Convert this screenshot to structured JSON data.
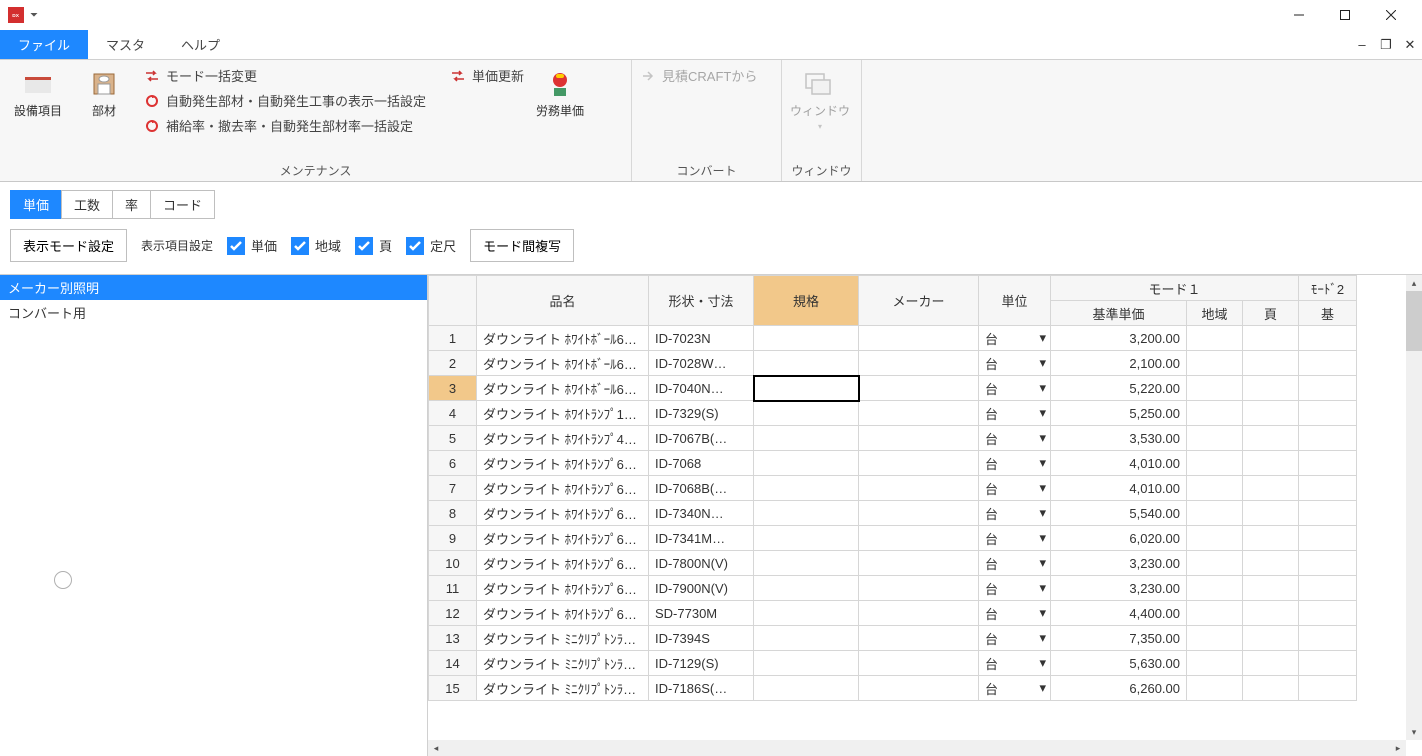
{
  "app": {
    "icon_text": "CRAFT DX",
    "qat_glyph": "⏷"
  },
  "window_controls": {
    "min": "–",
    "max": "☐",
    "close": "✕"
  },
  "menu": {
    "tabs": [
      {
        "label": "ファイル",
        "active": true
      },
      {
        "label": "マスタ",
        "active": false
      },
      {
        "label": "ヘルプ",
        "active": false
      }
    ],
    "mdi": {
      "min": "–",
      "restore": "❐",
      "close": "✕"
    }
  },
  "ribbon": {
    "groups": [
      {
        "label": "メンテナンス",
        "big": [
          {
            "text": "設備項目",
            "icon": "folder"
          },
          {
            "text": "部材",
            "icon": "toilet"
          }
        ],
        "items": [
          {
            "text": "モード一括変更",
            "icon": "swap"
          },
          {
            "text": "自動発生部材・自動発生工事の表示一括設定",
            "icon": "cycle-red"
          },
          {
            "text": "補給率・撤去率・自動発生部材率一括設定",
            "icon": "cycle-red"
          }
        ],
        "right_items": [
          {
            "text": "単価更新",
            "icon": "swap"
          }
        ],
        "right_big": [
          {
            "text": "労務単価",
            "icon": "worker"
          }
        ]
      },
      {
        "label": "コンバート",
        "items": [
          {
            "text": "見積CRAFTから",
            "icon": "arrow",
            "disabled": true
          }
        ]
      },
      {
        "label": "ウィンドウ",
        "big": [
          {
            "text": "ウィンドウ",
            "icon": "window",
            "disabled": true,
            "dropdown": true
          }
        ]
      }
    ]
  },
  "subtabs": [
    {
      "label": "単価",
      "active": true
    },
    {
      "label": "工数",
      "active": false
    },
    {
      "label": "率",
      "active": false
    },
    {
      "label": "コード",
      "active": false
    }
  ],
  "toolbar": {
    "display_mode": "表示モード設定",
    "display_items": "表示項目設定",
    "checks": [
      {
        "label": "単価"
      },
      {
        "label": "地域"
      },
      {
        "label": "頁"
      },
      {
        "label": "定尺"
      }
    ],
    "mode_copy": "モード間複写"
  },
  "sidebar": {
    "items": [
      {
        "label": "メーカー別照明",
        "selected": true
      },
      {
        "label": "コンバート用",
        "selected": false
      }
    ]
  },
  "grid": {
    "header_top": {
      "name": "品名",
      "shape": "形状・寸法",
      "spec": "規格",
      "maker": "メーカー",
      "unit": "単位",
      "mode1": "モード１",
      "mode2": "ﾓｰﾄﾞ2"
    },
    "header_sub": {
      "price": "基準単価",
      "region": "地域",
      "page": "頁",
      "base2": "基"
    },
    "selected_row": 3,
    "rows": [
      {
        "n": 1,
        "name": "ダウンライト ﾎﾜｲﾄﾎﾞｰﾙ60…",
        "shape": "ID-7023N",
        "unit": "台",
        "price": "3,200.00"
      },
      {
        "n": 2,
        "name": "ダウンライト ﾎﾜｲﾄﾎﾞｰﾙ60…",
        "shape": "ID-7028W…",
        "unit": "台",
        "price": "2,100.00"
      },
      {
        "n": 3,
        "name": "ダウンライト ﾎﾜｲﾄﾎﾞｰﾙ60…",
        "shape": "ID-7040N…",
        "unit": "台",
        "price": "5,220.00"
      },
      {
        "n": 4,
        "name": "ダウンライト ﾎﾜｲﾄﾗﾝﾌﾟ10…",
        "shape": "ID-7329(S)",
        "unit": "台",
        "price": "5,250.00"
      },
      {
        "n": 5,
        "name": "ダウンライト ﾎﾜｲﾄﾗﾝﾌﾟ40…",
        "shape": "ID-7067B(…",
        "unit": "台",
        "price": "3,530.00"
      },
      {
        "n": 6,
        "name": "ダウンライト ﾎﾜｲﾄﾗﾝﾌﾟ60…",
        "shape": "ID-7068",
        "unit": "台",
        "price": "4,010.00"
      },
      {
        "n": 7,
        "name": "ダウンライト ﾎﾜｲﾄﾗﾝﾌﾟ60…",
        "shape": "ID-7068B(…",
        "unit": "台",
        "price": "4,010.00"
      },
      {
        "n": 8,
        "name": "ダウンライト ﾎﾜｲﾄﾗﾝﾌﾟ60…",
        "shape": "ID-7340N…",
        "unit": "台",
        "price": "5,540.00"
      },
      {
        "n": 9,
        "name": "ダウンライト ﾎﾜｲﾄﾗﾝﾌﾟ60…",
        "shape": "ID-7341M…",
        "unit": "台",
        "price": "6,020.00"
      },
      {
        "n": 10,
        "name": "ダウンライト ﾎﾜｲﾄﾗﾝﾌﾟ60…",
        "shape": "ID-7800N(V)",
        "unit": "台",
        "price": "3,230.00"
      },
      {
        "n": 11,
        "name": "ダウンライト ﾎﾜｲﾄﾗﾝﾌﾟ60…",
        "shape": "ID-7900N(V)",
        "unit": "台",
        "price": "3,230.00"
      },
      {
        "n": 12,
        "name": "ダウンライト ﾎﾜｲﾄﾗﾝﾌﾟ60…",
        "shape": "SD-7730M",
        "unit": "台",
        "price": "4,400.00"
      },
      {
        "n": 13,
        "name": "ダウンライト ﾐﾆｸﾘﾌﾟﾄﾝﾗﾝ…",
        "shape": "ID-7394S",
        "unit": "台",
        "price": "7,350.00"
      },
      {
        "n": 14,
        "name": "ダウンライト ﾐﾆｸﾘﾌﾟﾄﾝﾗﾝ…",
        "shape": "ID-7129(S)",
        "unit": "台",
        "price": "5,630.00"
      },
      {
        "n": 15,
        "name": "ダウンライト ﾐﾆｸﾘﾌﾟﾄﾝﾗﾝ…",
        "shape": "ID-7186S(…",
        "unit": "台",
        "price": "6,260.00"
      }
    ]
  }
}
